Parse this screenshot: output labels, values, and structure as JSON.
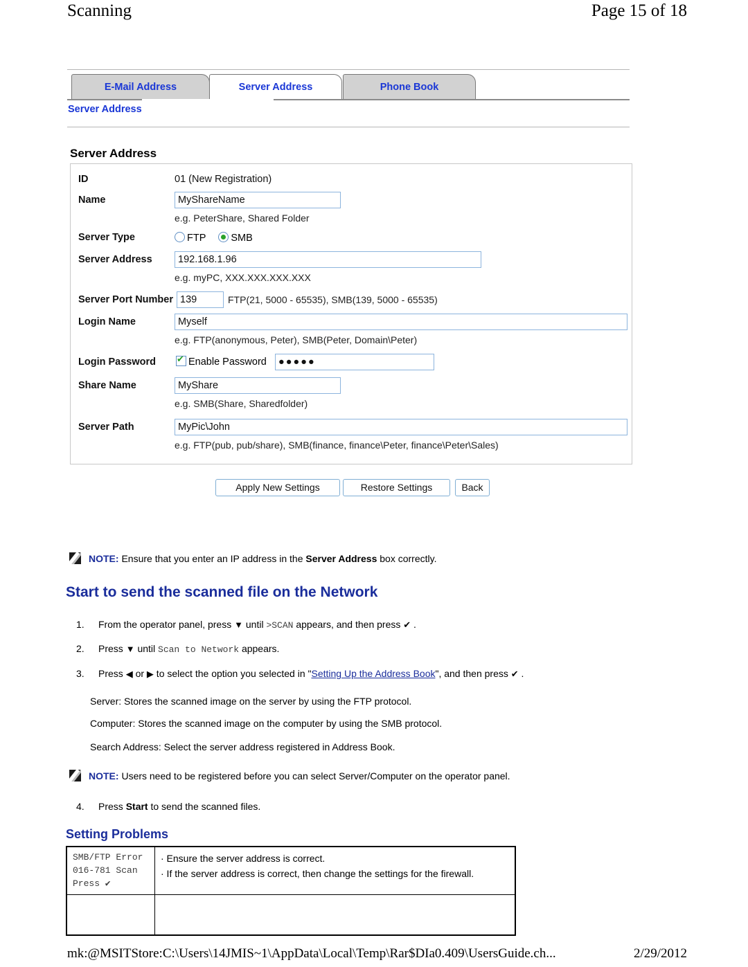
{
  "page_header": {
    "left_title": "Scanning",
    "right_title": "Page 15 of 18"
  },
  "tabs": [
    {
      "label": "E-Mail Address",
      "active": false
    },
    {
      "label": "Server Address",
      "active": true
    },
    {
      "label": "Phone Book",
      "active": false
    }
  ],
  "breadcrumb": "Server Address",
  "form": {
    "panel_title": "Server Address",
    "id": {
      "label": "ID",
      "value": "01 (New Registration)"
    },
    "name": {
      "label": "Name",
      "value": "MyShareName",
      "hint": "e.g. PeterShare, Shared Folder"
    },
    "server_type": {
      "label": "Server Type",
      "options": [
        "FTP",
        "SMB"
      ],
      "selected": "SMB"
    },
    "server_address": {
      "label": "Server Address",
      "value": "192.168.1.96",
      "hint": "e.g. myPC, XXX.XXX.XXX.XXX"
    },
    "server_port": {
      "label": "Server Port Number",
      "value": "139",
      "hint": "FTP(21, 5000 - 65535), SMB(139, 5000 - 65535)"
    },
    "login_name": {
      "label": "Login Name",
      "value": "Myself",
      "hint": "e.g. FTP(anonymous, Peter), SMB(Peter, Domain\\Peter)"
    },
    "login_password": {
      "label": "Login Password",
      "checkbox_label": "Enable Password",
      "checked": true,
      "value": "●●●●●"
    },
    "share_name": {
      "label": "Share Name",
      "value": "MyShare",
      "hint": "e.g. SMB(Share, Sharedfolder)"
    },
    "server_path": {
      "label": "Server Path",
      "value": "MyPic\\John",
      "hint": "e.g. FTP(pub, pub/share), SMB(finance, finance\\Peter, finance\\Peter\\Sales)"
    },
    "buttons": {
      "apply": "Apply New Settings",
      "restore": "Restore Settings",
      "back": "Back"
    }
  },
  "note1": {
    "label": "NOTE:",
    "text_before": " Ensure that you enter an IP address in the ",
    "bold": "Server Address",
    "text_after": " box correctly."
  },
  "section1": {
    "heading": "Start to send the scanned file on the Network",
    "steps": [
      {
        "num": "1.",
        "parts": [
          {
            "t": "From the operator panel, press "
          },
          {
            "t": "▼",
            "style": "glyph"
          },
          {
            "t": " until "
          },
          {
            "t": ">SCAN",
            "style": "mono"
          },
          {
            "t": " appears, and then press "
          },
          {
            "t": "✔",
            "style": "glyph"
          },
          {
            "t": " ."
          }
        ]
      },
      {
        "num": "2.",
        "parts": [
          {
            "t": "Press "
          },
          {
            "t": "▼",
            "style": "glyph"
          },
          {
            "t": " until "
          },
          {
            "t": "Scan to Network",
            "style": "mono"
          },
          {
            "t": " appears."
          }
        ]
      },
      {
        "num": "3.",
        "parts": [
          {
            "t": "Press "
          },
          {
            "t": "◀",
            "style": "glyph"
          },
          {
            "t": " or "
          },
          {
            "t": "▶",
            "style": "glyph"
          },
          {
            "t": " to select the option you selected in \""
          },
          {
            "t": "Setting Up the Address Book",
            "style": "link"
          },
          {
            "t": "\", and then press "
          },
          {
            "t": "✔",
            "style": "glyph"
          },
          {
            "t": " ."
          }
        ]
      }
    ],
    "paragraphs": [
      "Server: Stores the scanned image on the server by using the FTP protocol.",
      "Computer: Stores the scanned image on the computer by using the SMB protocol.",
      "Search Address: Select the server address registered in Address Book."
    ]
  },
  "note2": {
    "label": "NOTE:",
    "text": " Users need to be registered before you can select Server/Computer on the operator panel."
  },
  "step4": {
    "num": "4.",
    "text_before": "Press ",
    "bold": "Start",
    "text_after": " to send the scanned files."
  },
  "section2": {
    "heading": "Setting Problems",
    "rows": [
      {
        "code_lines": [
          "SMB/FTP Error",
          "016-781 Scan",
          "Press ✔"
        ],
        "solutions": [
          "· Ensure the server address is correct.",
          "· If the server address is correct, then change the settings for the firewall."
        ]
      },
      {
        "code_lines": [],
        "solutions": []
      }
    ]
  },
  "footer": {
    "path": "mk:@MSITStore:C:\\Users\\14JMIS~1\\AppData\\Local\\Temp\\Rar$DIa0.409\\UsersGuide.ch...",
    "date": "2/29/2012"
  }
}
